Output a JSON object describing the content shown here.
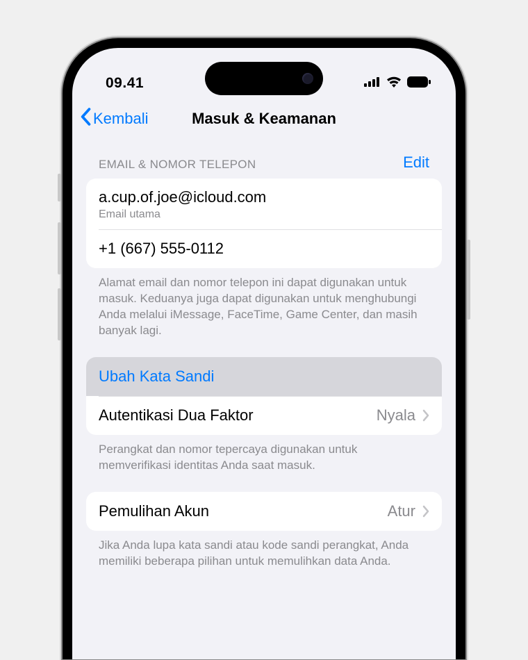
{
  "status": {
    "time": "09.41"
  },
  "nav": {
    "back": "Kembali",
    "title": "Masuk & Keamanan"
  },
  "contacts": {
    "header": "EMAIL & NOMOR TELEPON",
    "edit": "Edit",
    "email": "a.cup.of.joe@icloud.com",
    "email_sub": "Email utama",
    "phone": "+1 (667) 555-0112",
    "footer": "Alamat email dan nomor telepon ini dapat digunakan untuk masuk. Keduanya juga dapat digunakan untuk menghubungi Anda melalui iMessage, FaceTime, Game Center, dan masih banyak lagi."
  },
  "security": {
    "change_password": "Ubah Kata Sandi",
    "two_factor_label": "Autentikasi Dua Faktor",
    "two_factor_value": "Nyala",
    "footer": "Perangkat dan nomor tepercaya digunakan untuk memverifikasi identitas Anda saat masuk."
  },
  "recovery": {
    "label": "Pemulihan Akun",
    "value": "Atur",
    "footer": "Jika Anda lupa kata sandi atau kode sandi perangkat, Anda memiliki beberapa pilihan untuk memulihkan data Anda."
  }
}
